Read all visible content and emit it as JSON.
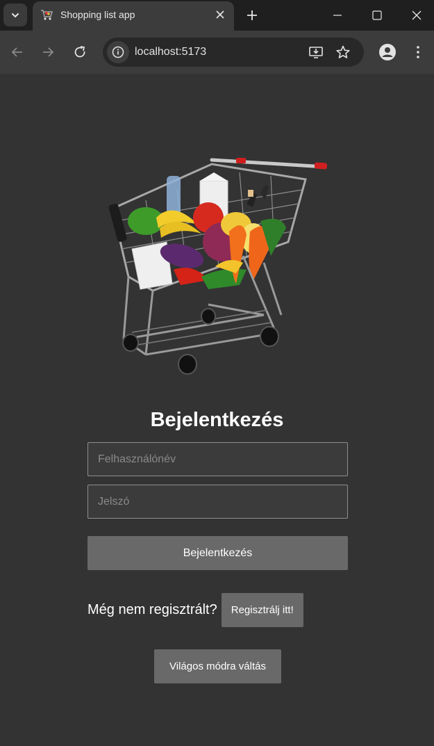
{
  "browser": {
    "tab_title": "Shopping list app",
    "url": "localhost:5173"
  },
  "login": {
    "title": "Bejelentkezés",
    "username_placeholder": "Felhasználónév",
    "password_placeholder": "Jelszó",
    "submit_label": "Bejelentkezés",
    "register_prompt": "Még nem regisztrált?",
    "register_label": "Regisztrálj itt!",
    "theme_toggle_label": "Világos módra váltás"
  },
  "colors": {
    "background": "#333333",
    "button": "#696969",
    "field_border": "#8f8f8f"
  },
  "icons": [
    "tab-search-icon",
    "cart-favicon",
    "close-icon",
    "plus-icon",
    "minimize-icon",
    "maximize-icon",
    "back-icon",
    "forward-icon",
    "reload-icon",
    "info-icon",
    "install-app-icon",
    "star-icon",
    "profile-icon",
    "menu-icon"
  ]
}
